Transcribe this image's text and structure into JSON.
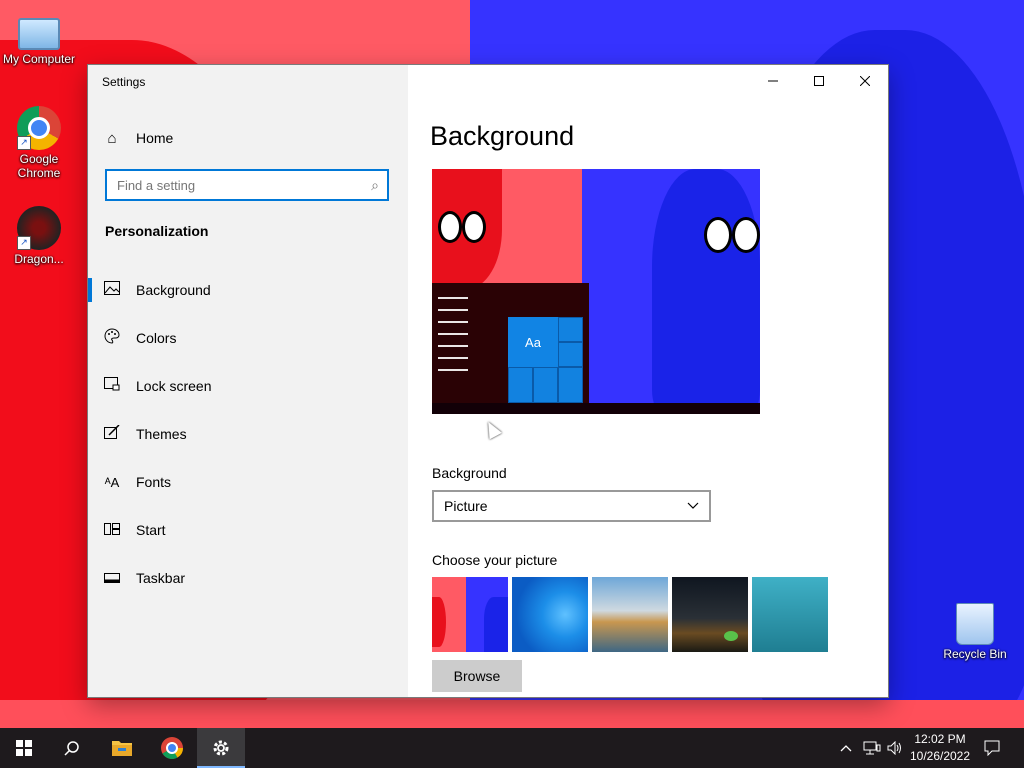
{
  "desktop": {
    "icons": [
      {
        "label": "My Computer",
        "icon": "computer-icon"
      },
      {
        "label": "Google Chrome",
        "icon": "chrome-icon"
      },
      {
        "label": "Dragon...",
        "icon": "dragon-app-icon"
      },
      {
        "label": "Recycle Bin",
        "icon": "recycle-bin-icon"
      }
    ]
  },
  "window": {
    "title": "Settings",
    "controls": {
      "minimize": "─",
      "maximize": "☐",
      "close": "✕"
    }
  },
  "sidebar": {
    "home_label": "Home",
    "search_placeholder": "Find a setting",
    "section_title": "Personalization",
    "items": [
      {
        "label": "Background",
        "icon": "picture-icon",
        "glyph": "🖼",
        "active": true
      },
      {
        "label": "Colors",
        "icon": "palette-icon",
        "glyph": "🎨",
        "active": false
      },
      {
        "label": "Lock screen",
        "icon": "lock-screen-icon",
        "glyph": "🖵",
        "active": false
      },
      {
        "label": "Themes",
        "icon": "themes-icon",
        "glyph": "✎",
        "active": false
      },
      {
        "label": "Fonts",
        "icon": "fonts-icon",
        "glyph": "A",
        "active": false
      },
      {
        "label": "Start",
        "icon": "start-icon",
        "glyph": "☷",
        "active": false
      },
      {
        "label": "Taskbar",
        "icon": "taskbar-icon",
        "glyph": "▭",
        "active": false
      }
    ]
  },
  "main": {
    "heading": "Background",
    "preview_tile_text": "Aa",
    "background_label": "Background",
    "background_value": "Picture",
    "choose_label": "Choose your picture",
    "browse_label": "Browse"
  },
  "taskbar": {
    "pinned": [
      "start-icon",
      "search-icon",
      "file-explorer-icon",
      "chrome-icon",
      "settings-icon"
    ],
    "time": "12:02 PM",
    "date": "10/26/2022"
  },
  "colors": {
    "accent": "#0078d7",
    "sidebar_bg": "#f2f2f2",
    "taskbar_bg": "#1e1a1d"
  }
}
